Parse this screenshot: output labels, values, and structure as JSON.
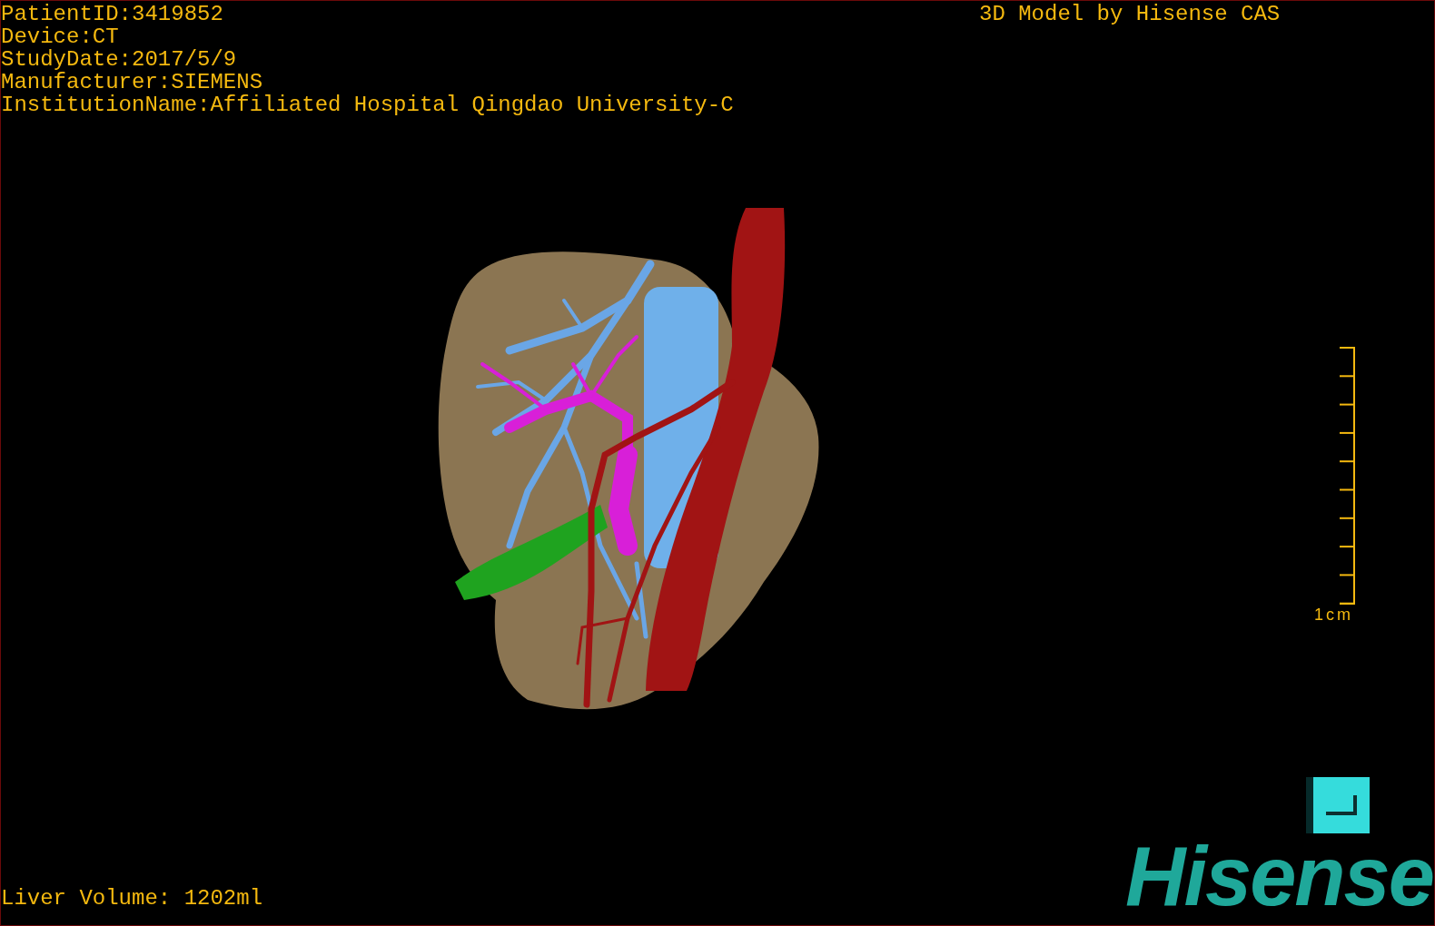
{
  "patient_info": [
    "PatientID:3419852",
    "Device:CT",
    "StudyDate:2017/5/9",
    "Manufacturer:SIEMENS",
    "InstitutionName:Affiliated Hospital Qingdao University-C"
  ],
  "model_credit": "3D Model by Hisense CAS",
  "scale_bar": {
    "label": "1cm"
  },
  "liver_volume": "Liver Volume: 1202ml",
  "logo": "Hisense"
}
